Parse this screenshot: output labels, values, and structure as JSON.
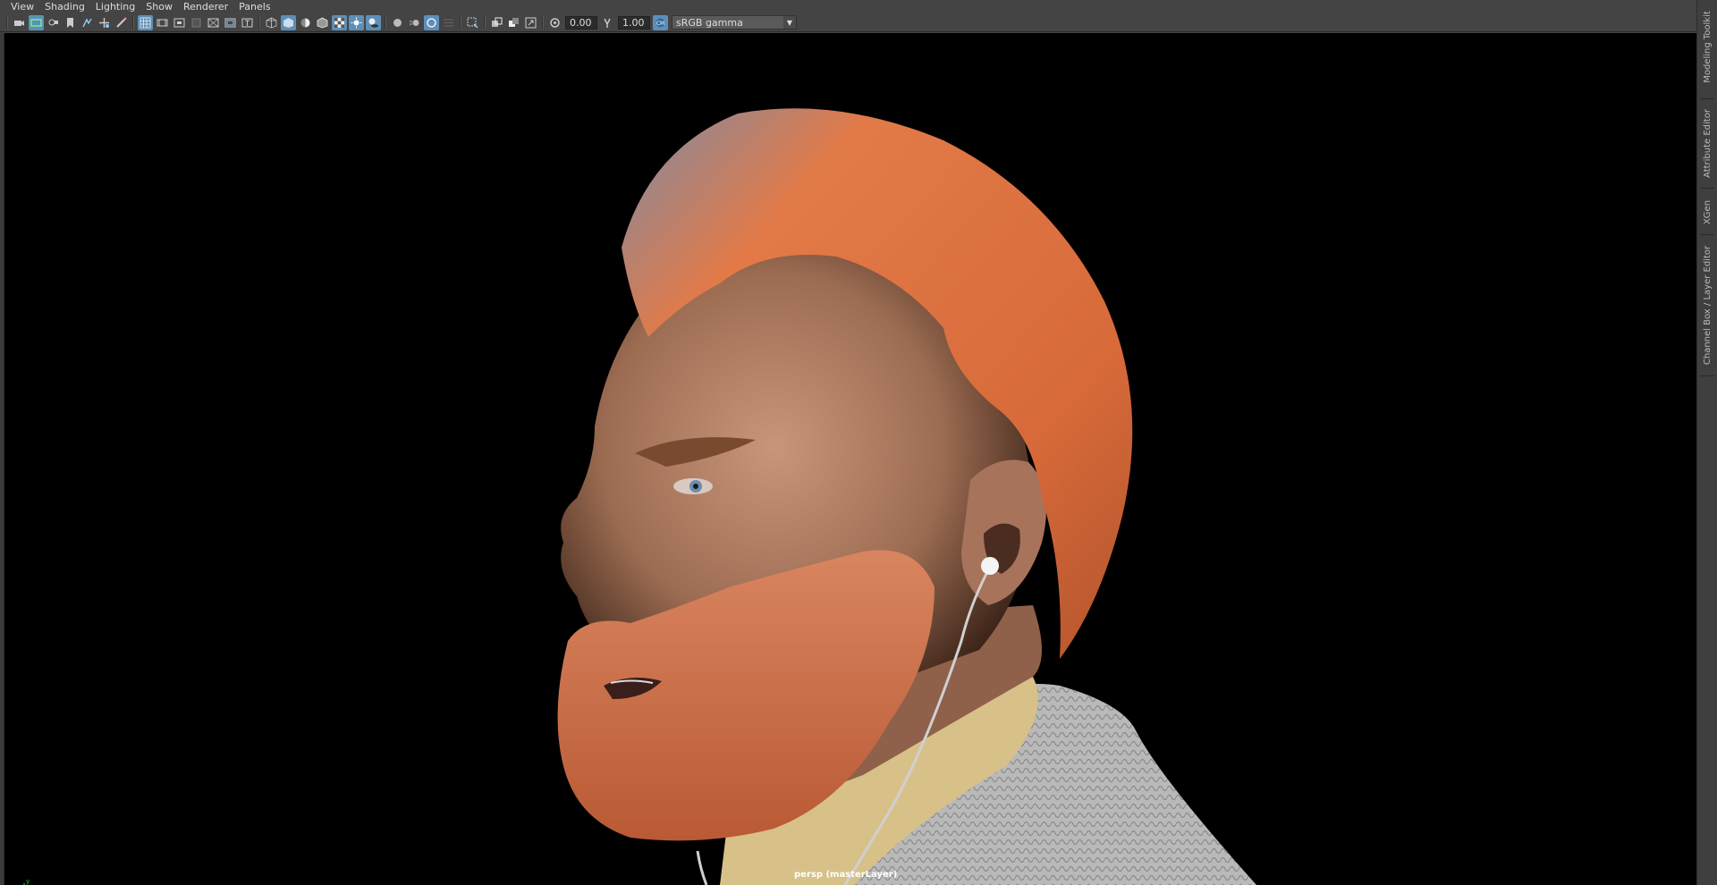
{
  "menu": [
    "View",
    "Shading",
    "Lighting",
    "Show",
    "Renderer",
    "Panels"
  ],
  "toolbar": {
    "exposure_value": "0.00",
    "gamma_value": "1.00",
    "color_space": "sRGB gamma",
    "icons": [
      "select-camera-icon",
      "camera-attributes-icon",
      "bookmark-icon",
      "image-plane-icon",
      "2d-pan-icon",
      "grease-pencil-icon",
      "grid-icon",
      "film-gate-icon",
      "resolution-gate-icon",
      "gate-mask-icon",
      "field-chart-icon",
      "safe-action-icon",
      "safe-title-icon",
      "wireframe-icon",
      "smooth-shade-icon",
      "default-material-icon",
      "wireframe-on-shaded-icon",
      "textured-icon",
      "use-all-lights-icon",
      "shadows-icon",
      "screen-space-ao-icon",
      "motion-blur-icon",
      "anti-aliasing-icon",
      "depth-of-field-icon",
      "isolate-select-icon",
      "xray-icon",
      "xray-joints-icon",
      "xray-active-components-icon",
      "exposure-icon",
      "gamma-icon",
      "color-management-icon"
    ]
  },
  "viewport": {
    "camera_label": "persp (masterLayer)"
  },
  "side_tabs": [
    "Modeling Toolkit",
    "Attribute Editor",
    "XGen",
    "Channel Box / Layer Editor"
  ],
  "colors": {
    "ui_bg": "#444444",
    "viewport_bg": "#000000",
    "active_button": "#5d8fb8",
    "hair": "#d2693a",
    "skin": "#b88566",
    "sweater": "#b9b9b9",
    "shirt": "#d8c089"
  }
}
